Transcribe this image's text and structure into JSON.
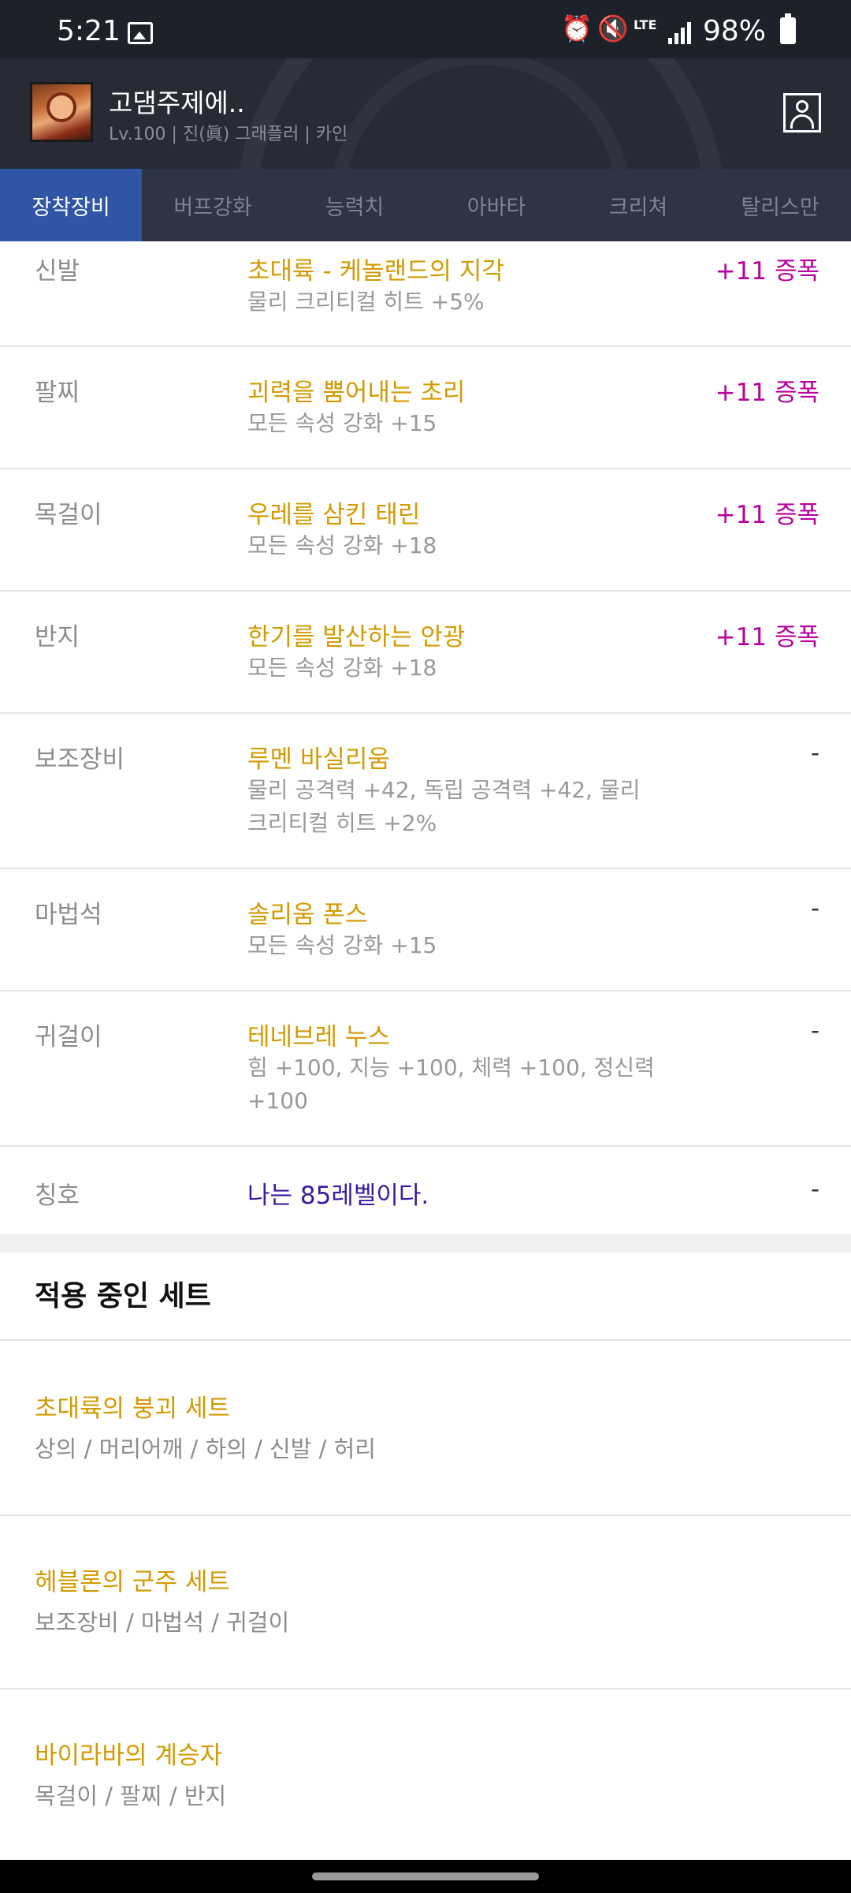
{
  "status_bar": {
    "time": "5:21",
    "network": "LTE",
    "battery": "98%"
  },
  "header": {
    "character_name": "고댐주제에..",
    "character_info": "Lv.100 | 진(眞) 그래플러 | 카인"
  },
  "tabs": [
    {
      "label": "장착장비",
      "active": true
    },
    {
      "label": "버프강화",
      "active": false
    },
    {
      "label": "능력치",
      "active": false
    },
    {
      "label": "아바타",
      "active": false
    },
    {
      "label": "크리쳐",
      "active": false
    },
    {
      "label": "탈리스만",
      "active": false
    }
  ],
  "equipment": [
    {
      "slot": "신발",
      "name": "초대륙 - 케놀랜드의 지각",
      "stat": "물리 크리티컬 히트 +5%",
      "enhance": "+11 증폭"
    },
    {
      "slot": "팔찌",
      "name": "괴력을 뿜어내는 초리",
      "stat": "모든 속성 강화 +15",
      "enhance": "+11 증폭"
    },
    {
      "slot": "목걸이",
      "name": "우레를 삼킨 태린",
      "stat": "모든 속성 강화 +18",
      "enhance": "+11 증폭"
    },
    {
      "slot": "반지",
      "name": "한기를 발산하는 안광",
      "stat": "모든 속성 강화 +18",
      "enhance": "+11 증폭"
    },
    {
      "slot": "보조장비",
      "name": "루멘 바실리움",
      "stat": "물리 공격력 +42, 독립 공격력 +42, 물리 크리티컬 히트 +2%",
      "enhance": "-"
    },
    {
      "slot": "마법석",
      "name": "솔리움 폰스",
      "stat": "모든 속성 강화 +15",
      "enhance": "-"
    },
    {
      "slot": "귀걸이",
      "name": "테네브레 누스",
      "stat": "힘 +100, 지능 +100, 체력 +100, 정신력 +100",
      "enhance": "-"
    },
    {
      "slot": "칭호",
      "name": "나는 85레벨이다.",
      "stat": "",
      "enhance": "-"
    }
  ],
  "sets_section": {
    "title": "적용 중인 세트",
    "sets": [
      {
        "name": "초대륙의 붕괴 세트",
        "parts": "상의 / 머리어깨 / 하의 / 신발 / 허리"
      },
      {
        "name": "헤블론의 군주 세트",
        "parts": "보조장비 / 마법석 / 귀걸이"
      },
      {
        "name": "바이라바의 계승자",
        "parts": "목걸이 / 팔찌 / 반지"
      }
    ]
  },
  "colors": {
    "item_name": "#d39a00",
    "title_name": "#3d1aa0",
    "enhance": "#b7009c",
    "active_tab": "#2f55a4"
  }
}
